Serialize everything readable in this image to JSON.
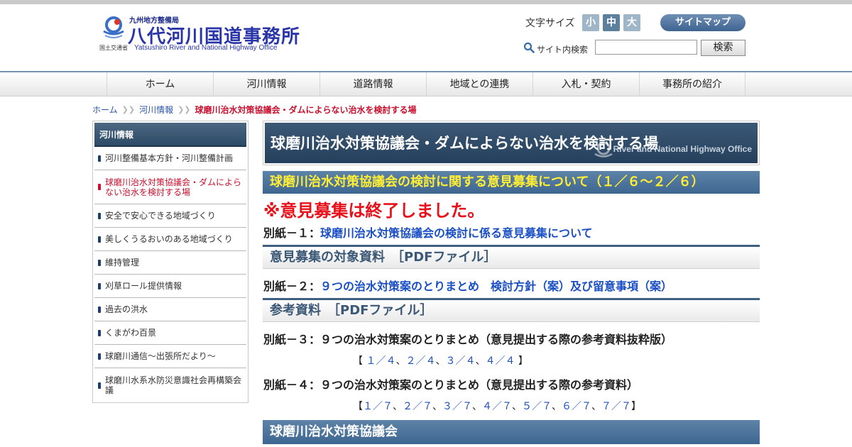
{
  "header": {
    "bureau": "九州地方整備局",
    "office_name": "八代河川国道事務所",
    "ministry": "国土交通省",
    "office_name_en": "Yatsushiro River and National Highway Office",
    "font_size_label": "文字サイズ",
    "font_sizes": [
      "小",
      "中",
      "大"
    ],
    "sitemap_label": "サイトマップ",
    "search_label": "サイト内検索",
    "search_value": "",
    "search_button": "検索"
  },
  "nav": [
    "ホーム",
    "河川情報",
    "道路情報",
    "地域との連携",
    "入札・契約",
    "事務所の紹介"
  ],
  "breadcrumb": {
    "items": [
      "ホーム",
      "河川情報"
    ],
    "current": "球磨川治水対策協議会・ダムによらない治水を検討する場"
  },
  "sidebar": {
    "heading": "河川情報",
    "items": [
      "河川整備基本方針・河川整備計画",
      "球磨川治水対策協議会・ダムによらない治水を検討する場",
      "安全で安心できる地域づくり",
      "美しくうるおいのある地域づくり",
      "維持管理",
      "刈草ロール提供情報",
      "過去の洪水",
      "くまがわ百景",
      "球磨川通信～出張所だより～",
      "球磨川水系水防災意識社会再構築会議"
    ],
    "active_index": 1
  },
  "main": {
    "title": "球磨川治水対策協議会・ダムによらない治水を検討する場",
    "watermark": "River and National Highway Office",
    "notice_heading": "球磨川治水対策協議会の検討に関する意見募集について（１／６～２／６）",
    "closed_notice": "※意見募集は終了しました。",
    "doc1": {
      "prefix": "別紙－１：",
      "link": "球磨川治水対策協議会の検討に係る意見募集について"
    },
    "section1": "意見募集の対象資料　［PDFファイル］",
    "doc2": {
      "prefix": "別紙－２：",
      "link": "９つの治水対策案のとりまとめ　検討方針（案）及び留意事項（案）"
    },
    "section2": "参考資料　［PDFファイル］",
    "doc3": {
      "text": "別紙－３：９つの治水対策案のとりまとめ（意見提出する際の参考資料抜粋版）",
      "pages": [
        "１／４",
        "２／４",
        "３／４",
        "４／４"
      ]
    },
    "doc4": {
      "text": "別紙－４：９つの治水対策案のとりまとめ（意見提出する際の参考資料）",
      "pages": [
        "１／７",
        "２／７",
        "３／７",
        "４／７",
        "５／７",
        "６／７",
        "７／７"
      ]
    },
    "bottom_heading": "球磨川治水対策協議会"
  },
  "colors": {
    "nav_border": "#7893b1",
    "heading_bg": "#3b5876",
    "notice_text": "#ffee33",
    "alert": "#e8101a",
    "link": "#1a4fc4",
    "breadcrumb_current": "#c8102e"
  }
}
